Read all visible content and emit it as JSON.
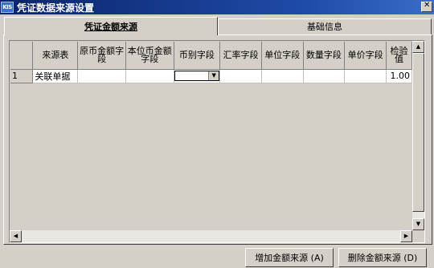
{
  "window": {
    "title": "凭证数据来源设置",
    "app_icon": "KIS"
  },
  "tabs": [
    {
      "label": "凭证金额来源",
      "active": true
    },
    {
      "label": "基础信息",
      "active": false
    }
  ],
  "grid": {
    "columns": [
      "",
      "来源表",
      "原币金额字段",
      "本位币金额字段",
      "币别字段",
      "汇率字段",
      "单位字段",
      "数量字段",
      "单价字段",
      "检验值"
    ],
    "rows": [
      {
        "num": "1",
        "source": "关联单据",
        "orig_amount": "",
        "base_amount": "",
        "currency": "",
        "rate": "",
        "unit": "",
        "qty": "",
        "price": "",
        "check": "1.00"
      }
    ]
  },
  "buttons": {
    "add": "增加金额来源 (A)",
    "delete": "删除金额来源 (D)"
  },
  "icons": {
    "close": "close-icon",
    "dropdown": "chevron-down-icon"
  }
}
